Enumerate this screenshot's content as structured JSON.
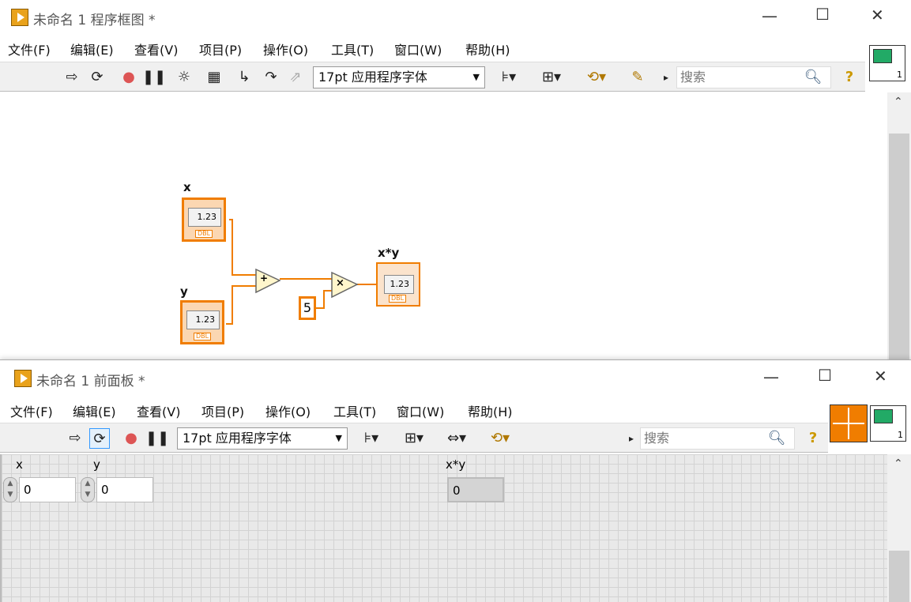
{
  "diagram_window": {
    "title": "未命名 1 程序框图 *",
    "menu": [
      "文件(F)",
      "编辑(E)",
      "查看(V)",
      "项目(P)",
      "操作(O)",
      "工具(T)",
      "窗口(W)",
      "帮助(H)"
    ],
    "font_select": "17pt 应用程序字体",
    "search_placeholder": "搜索",
    "help_symbol": "?",
    "connector_index": "1",
    "labels": {
      "x": "x",
      "y": "y",
      "xy": "x*y"
    },
    "ctrl_value": "1.23",
    "type_tag": "DBL",
    "add_symbol": "+",
    "mul_symbol": "×",
    "constant": "5"
  },
  "panel_window": {
    "title": "未命名 1 前面板 *",
    "menu": [
      "文件(F)",
      "编辑(E)",
      "查看(V)",
      "项目(P)",
      "操作(O)",
      "工具(T)",
      "窗口(W)",
      "帮助(H)"
    ],
    "font_select": "17pt 应用程序字体",
    "search_placeholder": "搜索",
    "help_symbol": "?",
    "connector_index": "1",
    "controls": [
      {
        "label": "x",
        "value": "0"
      },
      {
        "label": "y",
        "value": "0"
      }
    ],
    "indicator": {
      "label": "x*y",
      "value": "0"
    }
  },
  "colors": {
    "accent_orange": "#f07d00",
    "icon_yellow": "#e9a21b"
  }
}
